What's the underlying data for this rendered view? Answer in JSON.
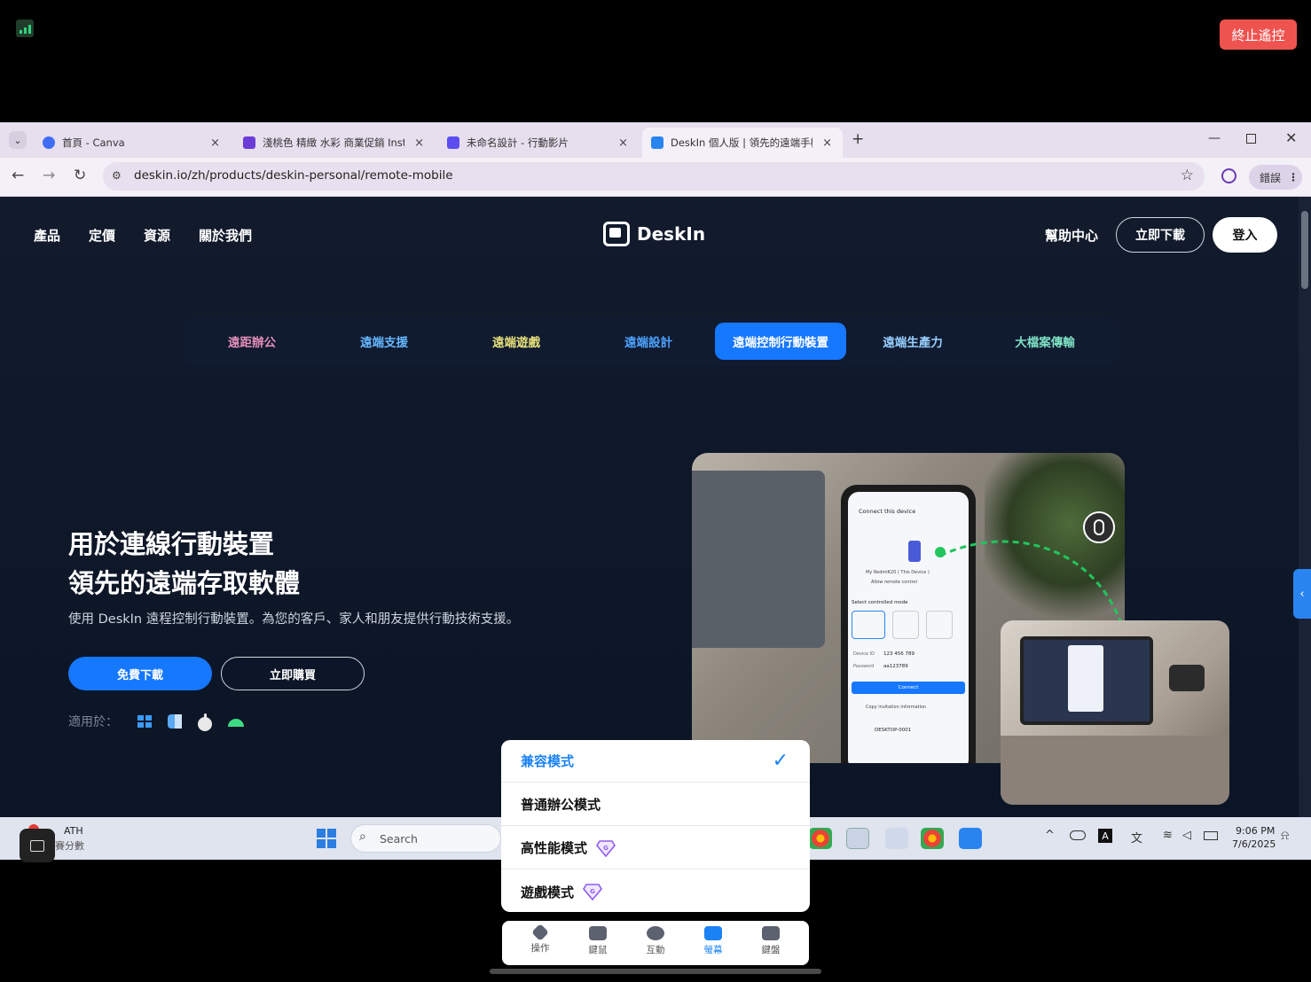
{
  "remote": {
    "stop_label": "終止遙控"
  },
  "browser": {
    "tabs": [
      {
        "label": "首頁 - Canva",
        "close": "×"
      },
      {
        "label": "淺桃色 精緻 水彩 商業促銷 Inst",
        "close": "×"
      },
      {
        "label": "未命名設計 - 行動影片",
        "close": "×"
      },
      {
        "label": "DeskIn 個人版 | 領先的遠端手機",
        "close": "×"
      }
    ],
    "new_tab": "+",
    "url": "deskin.io/zh/products/deskin-personal/remote-mobile",
    "profile_label": "錯誤"
  },
  "site": {
    "nav": [
      "產品",
      "定價",
      "資源",
      "關於我們"
    ],
    "logo": "DeskIn",
    "help": "幫助中心",
    "download": "立即下載",
    "login": "登入",
    "subnav": [
      "遠距辦公",
      "遠端支援",
      "遠端遊戲",
      "遠端設計",
      "遠端控制行動裝置",
      "遠端生產力",
      "大檔案傳輸"
    ],
    "subnav_colors": [
      "#e58fb8",
      "#66b7ff",
      "#e7e07a",
      "#4da3ff",
      "#ffffff",
      "#9ad0ff",
      "#7ee0c3"
    ],
    "hero_line1": "用於連線行動裝置",
    "hero_line2": "領先的遠端存取軟體",
    "hero_sub": "使用 DeskIn 遠程控制行動裝置。為您的客戶、家人和朋友提供行動技術支援。",
    "btn_free": "免費下載",
    "btn_buy": "立即購買",
    "available": "適用於：",
    "side_tab": "‹"
  },
  "phone_screen": {
    "title": "Connect this device",
    "device": "My RedmiK20 ( This Device )",
    "allow": "Allow remote control",
    "mode_title": "Select controlled mode",
    "device_id_label": "Device ID",
    "device_id": "123 456 789",
    "password_label": "Password",
    "password": "aa123789",
    "connect": "Connect",
    "copy": "Copy invitation information",
    "desktop": "DESKTOP-0001"
  },
  "taskbar": {
    "weather_line1": "ATH",
    "weather_line2": "賽分數",
    "search_placeholder": "Search",
    "time": "9:06 PM",
    "date": "7/6/2025"
  },
  "mode_menu": {
    "items": [
      "兼容模式",
      "普通辦公模式",
      "高性能模式",
      "遊戲模式"
    ],
    "selected": "兼容模式",
    "check": "✓",
    "gem_letter": "G"
  },
  "toolbar": {
    "items": [
      "操作",
      "鍵鼠",
      "互動",
      "螢幕",
      "鍵盤"
    ],
    "active": "螢幕"
  }
}
